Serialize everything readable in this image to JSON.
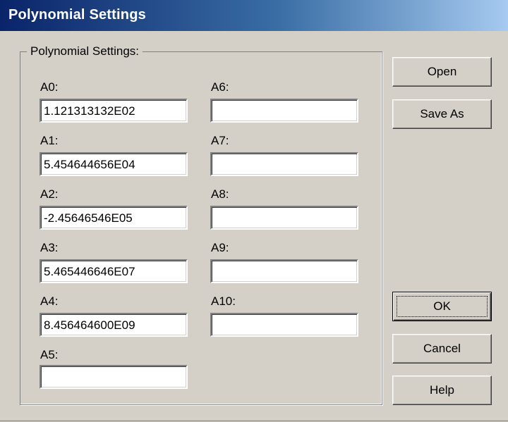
{
  "window": {
    "title": "Polynomial Settings"
  },
  "group": {
    "legend": "Polynomial Settings:"
  },
  "coefficients": [
    {
      "label": "A0:",
      "value": "1.121313132E02"
    },
    {
      "label": "A1:",
      "value": "5.454644656E04"
    },
    {
      "label": "A2:",
      "value": "-2.45646546E05"
    },
    {
      "label": "A3:",
      "value": "5.465446646E07"
    },
    {
      "label": "A4:",
      "value": "8.456464600E09"
    },
    {
      "label": "A5:",
      "value": ""
    },
    {
      "label": "A6:",
      "value": ""
    },
    {
      "label": "A7:",
      "value": ""
    },
    {
      "label": "A8:",
      "value": ""
    },
    {
      "label": "A9:",
      "value": ""
    },
    {
      "label": "A10:",
      "value": ""
    }
  ],
  "buttons": {
    "open": "Open",
    "save_as": "Save As",
    "ok": "OK",
    "cancel": "Cancel",
    "help": "Help"
  },
  "colors": {
    "titlebar_start": "#0a246a",
    "titlebar_end": "#a6caf0",
    "face": "#d4d0c8"
  }
}
